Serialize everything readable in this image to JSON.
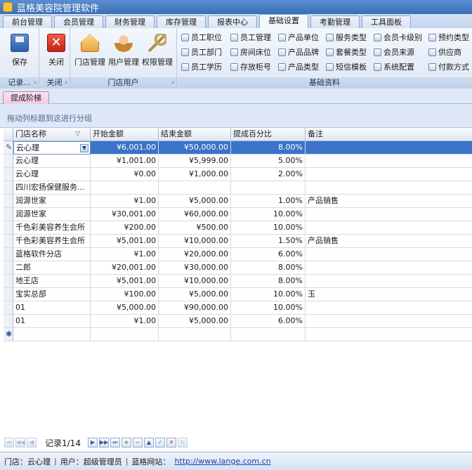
{
  "window": {
    "title": "蓝格美容院管理软件"
  },
  "menu_tabs": [
    {
      "label": "前台管理"
    },
    {
      "label": "会员管理"
    },
    {
      "label": "财务管理"
    },
    {
      "label": "库存管理"
    },
    {
      "label": "报表中心"
    },
    {
      "label": "基础设置"
    },
    {
      "label": "考勤管理"
    },
    {
      "label": "工具面板"
    }
  ],
  "active_tab": "基础设置",
  "ribbon": {
    "group_record": {
      "label": "记录...",
      "save": "保存"
    },
    "group_close": {
      "label": "关闭",
      "close": "关闭"
    },
    "group_store_user": {
      "label": "门店用户",
      "store_mgmt": "门店管理",
      "user_mgmt": "用户管理",
      "perm_mgmt": "权限管理"
    },
    "group_basic": {
      "label": "基础资料",
      "items": [
        {
          "label": "员工职位"
        },
        {
          "label": "员工管理"
        },
        {
          "label": "产品单位"
        },
        {
          "label": "服务类型"
        },
        {
          "label": "会员卡级别"
        },
        {
          "label": "预约类型"
        },
        {
          "label": "员工部门"
        },
        {
          "label": "房间床位"
        },
        {
          "label": "产品品牌"
        },
        {
          "label": "套餐类型"
        },
        {
          "label": "会员来源"
        },
        {
          "label": "供应商"
        },
        {
          "label": "员工学历"
        },
        {
          "label": "存放柜号"
        },
        {
          "label": "产品类型"
        },
        {
          "label": "短信模板"
        },
        {
          "label": "系统配置"
        },
        {
          "label": "付款方式"
        }
      ]
    }
  },
  "page_tab": "提成阶梯",
  "group_panel_hint": "拖动列标题到这进行分组",
  "table": {
    "columns": [
      "门店名称",
      "开始金额",
      "结束金额",
      "提成百分比",
      "备注"
    ],
    "rows": [
      [
        "云心理",
        "¥6,001.00",
        "¥50,000.00",
        "8.00%",
        ""
      ],
      [
        "云心理",
        "¥1,001.00",
        "¥5,999.00",
        "5.00%",
        ""
      ],
      [
        "云心理",
        "¥0.00",
        "¥1,000.00",
        "2.00%",
        ""
      ],
      [
        "四川宏扬保健服务...",
        "",
        "",
        "",
        ""
      ],
      [
        "润源世家",
        "¥1.00",
        "¥5,000.00",
        "1.00%",
        "产品销售"
      ],
      [
        "润源世家",
        "¥30,001.00",
        "¥60,000.00",
        "10.00%",
        ""
      ],
      [
        "千色彩美容养生会所",
        "¥200.00",
        "¥500.00",
        "10.00%",
        ""
      ],
      [
        "千色彩美容养生会所",
        "¥5,001.00",
        "¥10,000.00",
        "1.50%",
        "产品销售"
      ],
      [
        "蓝格软件分店",
        "¥1.00",
        "¥20,000.00",
        "6.00%",
        ""
      ],
      [
        "二郎",
        "¥20,001.00",
        "¥30,000.00",
        "8.00%",
        ""
      ],
      [
        "地王店",
        "¥5,001.00",
        "¥10,000.00",
        "8.00%",
        ""
      ],
      [
        "宝实总部",
        "¥100.00",
        "¥5,000.00",
        "10.00%",
        "玉"
      ],
      [
        "01",
        "¥5,000.00",
        "¥90,000.00",
        "10.00%",
        ""
      ],
      [
        "01",
        "¥1.00",
        "¥5,000.00",
        "6.00%",
        ""
      ]
    ]
  },
  "navigator": {
    "record_text": "记录1/14"
  },
  "status": {
    "store": "门店：云心理",
    "user": "用户：超级管理员",
    "site_label": "蓝格网站：",
    "site_url": "http://www.lange.com.cn"
  }
}
